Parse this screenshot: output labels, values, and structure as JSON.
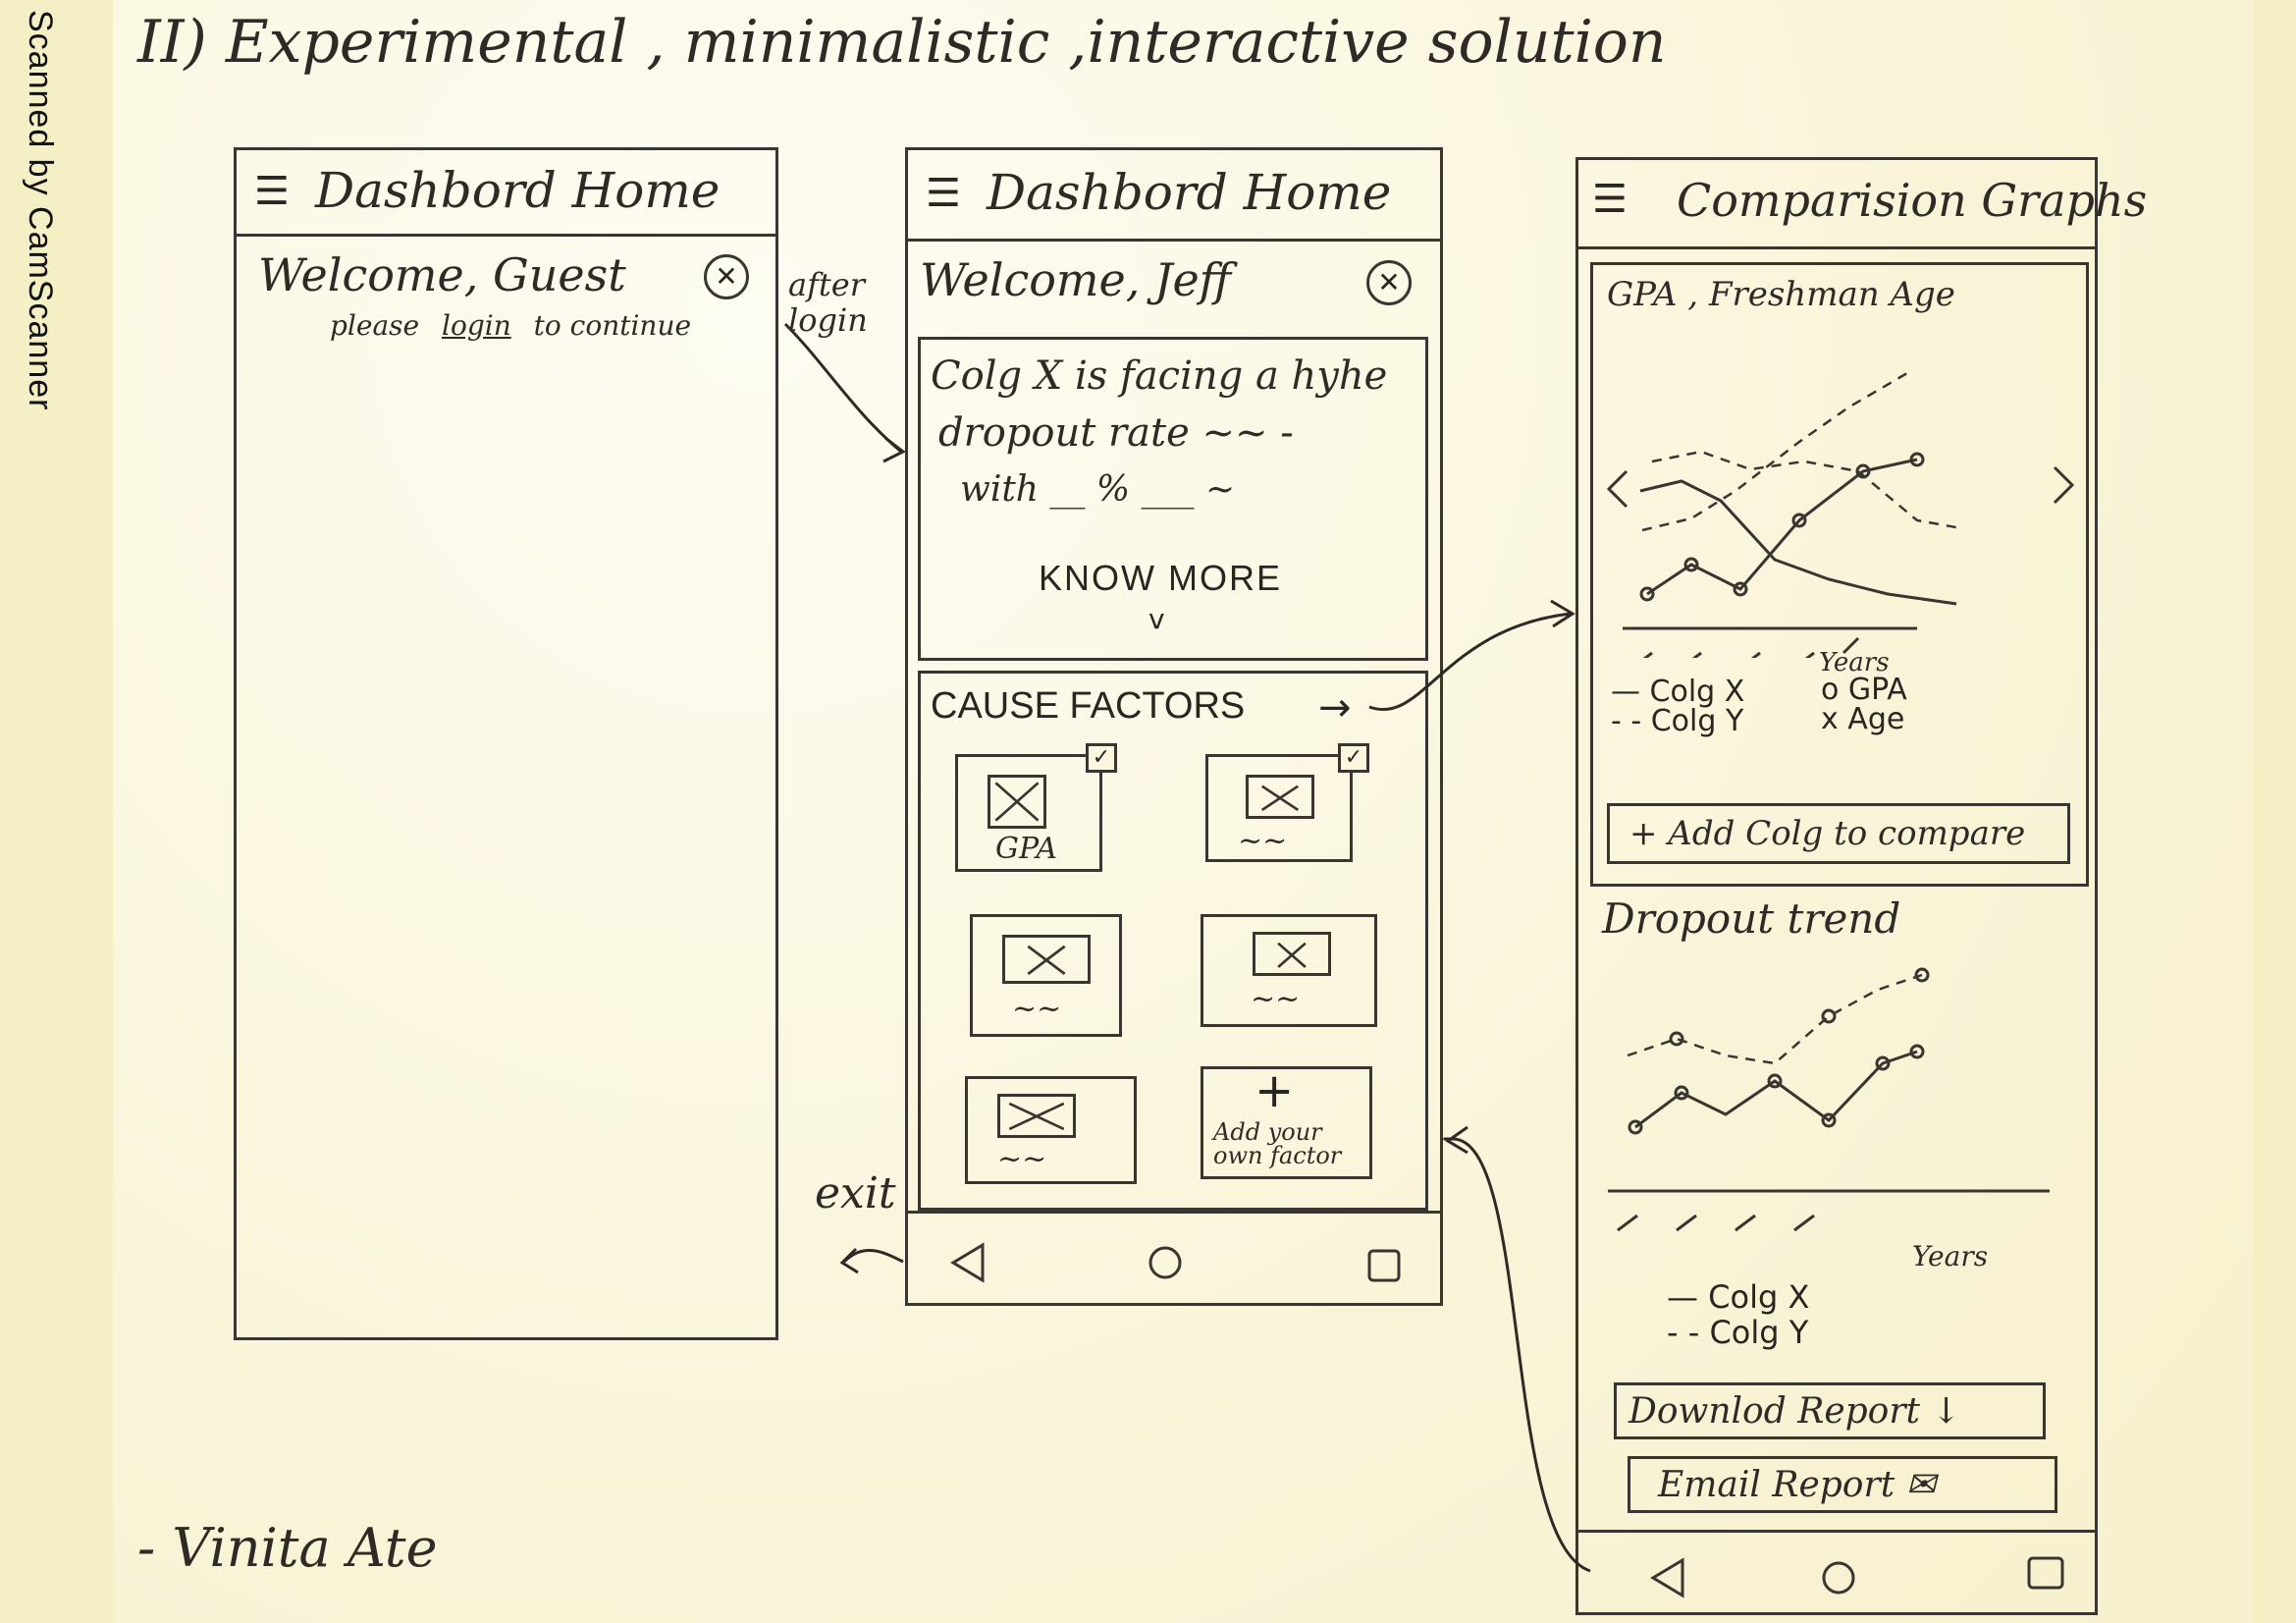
{
  "scanner_tag": "Scanned by CamScanner",
  "page_heading": "II) Experimental , minimalistic ,interactive solution",
  "author": "- Vinita Ate",
  "annotations": {
    "after_login": "after login",
    "exit": "exit"
  },
  "screen1": {
    "header_title": "Dashbord Home",
    "welcome": "Welcome, Guest",
    "please": "please",
    "login_link": "login",
    "to_continue": "to continue"
  },
  "screen2": {
    "header_title": "Dashbord Home",
    "welcome": "Welcome, Jeff",
    "alert_line1": "Colg X is facing a hyhe",
    "alert_line2": "dropout rate ~~ -",
    "alert_line3": "with __ % ___ ~",
    "know_more": "KNOW MORE",
    "know_more_chevron": "v",
    "cause_factors": "CAUSE FACTORS",
    "factor_tiles": [
      {
        "caption": "GPA",
        "checked": true
      },
      {
        "caption": "~~",
        "checked": true
      },
      {
        "caption": "~~",
        "checked": false
      },
      {
        "caption": "~~",
        "checked": false
      },
      {
        "caption": "~~",
        "checked": false
      }
    ],
    "add_factor_plus": "+",
    "add_factor_label": "Add your own factor"
  },
  "screen3": {
    "header_title": "Comparision Graphs",
    "gpa_card_title": "GPA , Freshman Age",
    "gpa_xlabel": "Years",
    "gpa_legend": [
      "— Colg X",
      "- - Colg Y"
    ],
    "gpa_markers": [
      "o GPA",
      "x Age"
    ],
    "add_college": "+ Add Colg to compare",
    "dropout_title": "Dropout trend",
    "dropout_xlabel": "Years",
    "dropout_legend": [
      "— Colg X",
      "- - Colg Y"
    ],
    "download_report": "Downlod Report ↓",
    "email_report": "Email Report ✉"
  },
  "colors": {
    "ink": "#2f2a26",
    "paper": "#fbf7df",
    "scanner_edge": "#f4efc4"
  }
}
